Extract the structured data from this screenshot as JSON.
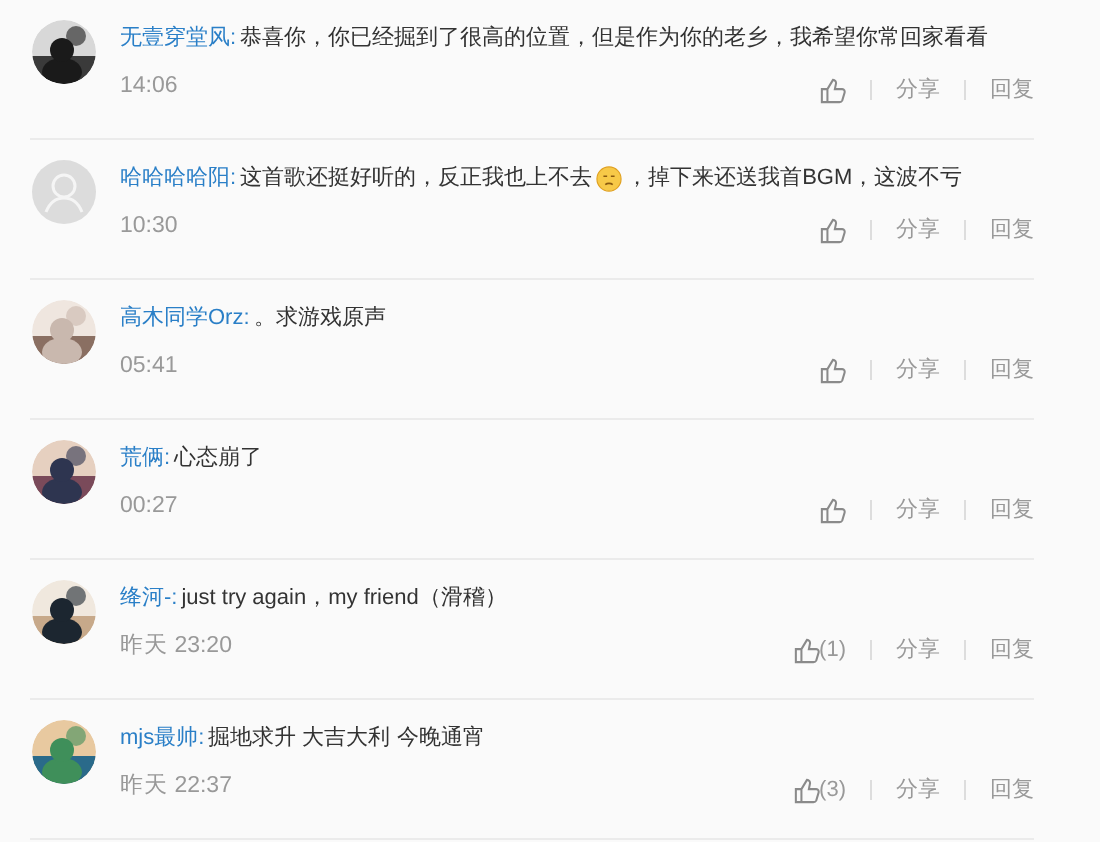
{
  "comments": [
    {
      "user": "无壹穿堂风:",
      "text": [
        {
          "kind": "text",
          "value": "恭喜你，你已经掘到了很高的位置，但是作为你的老乡，我希望你常回家看看"
        }
      ],
      "time": "14:06",
      "actions": {
        "share": "分享",
        "reply": "回复"
      }
    },
    {
      "avatar": {
        "kind": "default"
      },
      "user": "哈哈哈哈阳:",
      "text": [
        {
          "kind": "text",
          "value": "这首歌还挺好听的，反正我也上不去"
        },
        {
          "kind": "emoji"
        },
        {
          "kind": "text",
          "value": "，掉下来还送我首BGM，这波不亏"
        }
      ],
      "time": "10:30",
      "actions": {
        "share": "分享",
        "reply": "回复"
      }
    },
    {
      "user": "高木同学Orz:",
      "text": [
        {
          "kind": "text",
          "value": "。求游戏原声"
        }
      ],
      "time": "05:41",
      "actions": {
        "share": "分享",
        "reply": "回复"
      }
    },
    {
      "user": "荒俩:",
      "text": [
        {
          "kind": "text",
          "value": "心态崩了"
        }
      ],
      "time": "00:27",
      "actions": {
        "share": "分享",
        "reply": "回复"
      }
    },
    {
      "user": "绛河-:",
      "text": [
        {
          "kind": "text",
          "value": "just try again，my friend（滑稽）"
        }
      ],
      "time": "昨天 23:20",
      "likes": "(1)",
      "actions": {
        "share": "分享",
        "reply": "回复"
      }
    },
    {
      "user": "mjs最帅:",
      "text": [
        {
          "kind": "text",
          "value": "掘地求升 大吉大利 今晚通宵"
        }
      ],
      "time": "昨天 22:37",
      "likes": "(3)",
      "actions": {
        "share": "分享",
        "reply": "回复"
      }
    }
  ]
}
